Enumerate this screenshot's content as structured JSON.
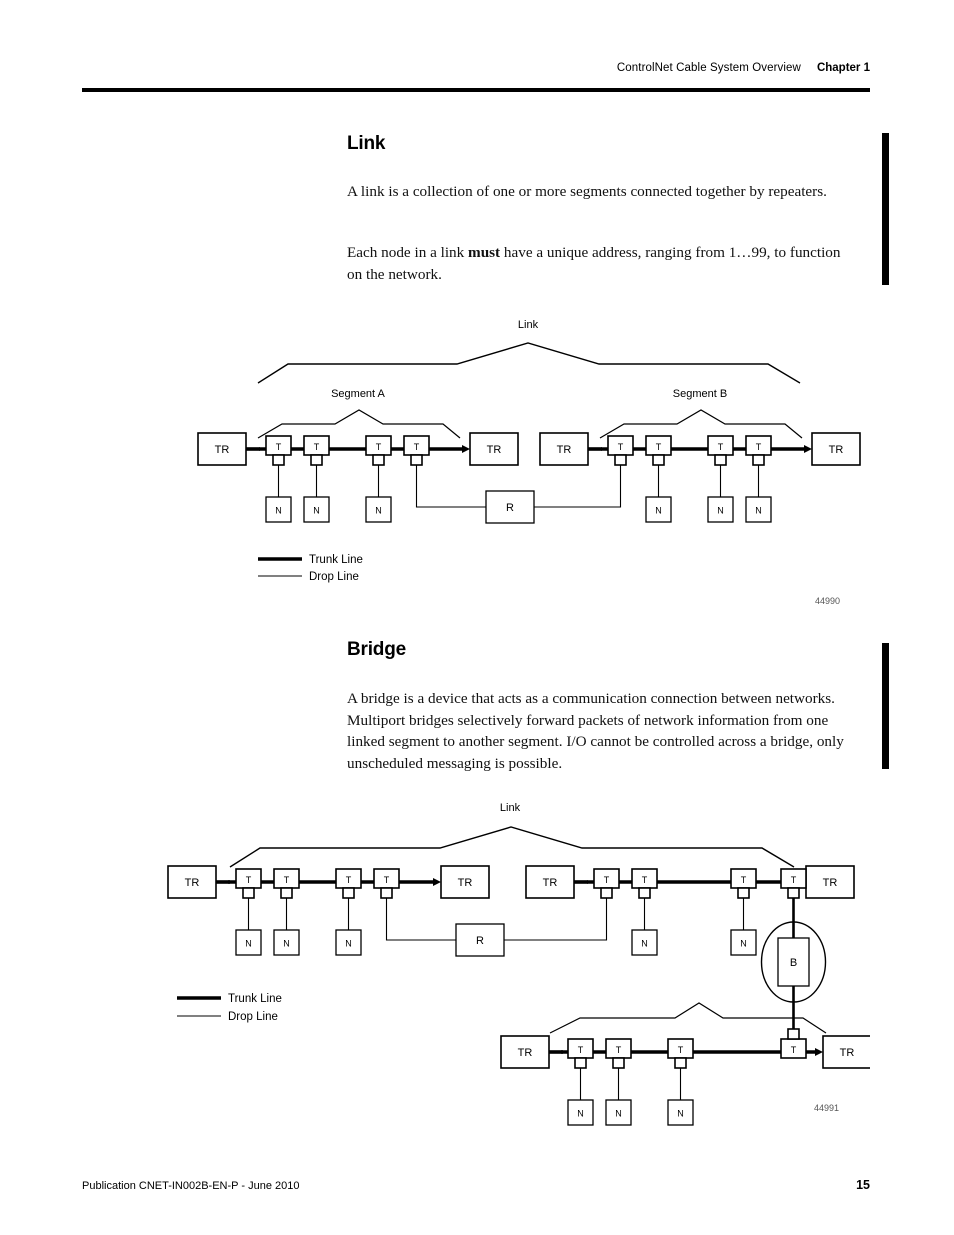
{
  "header": {
    "title": "ControlNet Cable System Overview",
    "chapter": "Chapter 1"
  },
  "sections": [
    {
      "heading": "Link",
      "paragraphs": [
        "A link is a collection of one or more segments connected together by repeaters.",
        "Each node in a link must have a unique address, ranging from 1…99, to function on the network."
      ],
      "para2_pre": "Each node in a link ",
      "para2_bold": "must",
      "para2_post": " have a unique address, ranging from 1…99, to function on the network."
    },
    {
      "heading": "Bridge",
      "paragraphs": [
        "A bridge is a device that acts as a communication connection between networks. Multiport bridges selectively forward packets of network information from one linked segment to another segment. I/O cannot be controlled across a bridge, only unscheduled messaging is possible."
      ]
    }
  ],
  "figure1": {
    "id": "44990",
    "link_label": "Link",
    "segment_a_label": "Segment A",
    "segment_b_label": "Segment B",
    "terminator_label": "TR",
    "tap_label": "T",
    "node_label": "N",
    "repeater_label": "R",
    "legend": {
      "trunk": "Trunk Line",
      "drop": "Drop Line"
    }
  },
  "figure2": {
    "id": "44991",
    "link_label": "Link",
    "terminator_label": "TR",
    "tap_label": "T",
    "node_label": "N",
    "repeater_label": "R",
    "bridge_label": "B",
    "legend": {
      "trunk": "Trunk Line",
      "drop": "Drop Line"
    }
  },
  "footer": {
    "publication": "Publication CNET-IN002B-EN-P - June 2010",
    "page": "15"
  },
  "colors": {
    "ink": "#000000",
    "rule": "#000000"
  }
}
